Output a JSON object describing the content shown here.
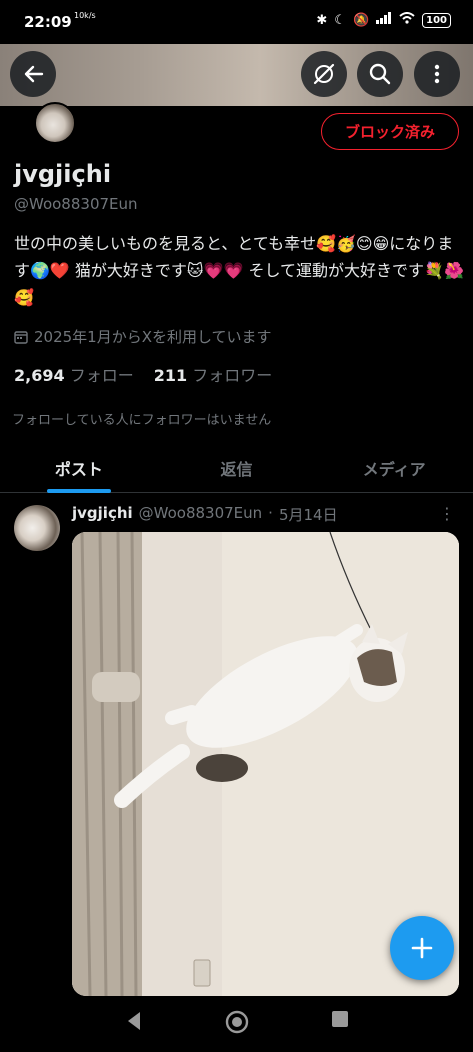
{
  "status": {
    "time": "22:09",
    "network": "10k/s",
    "battery": "100"
  },
  "profile": {
    "name": "jvgjiçhi",
    "handle": "@Woo88307Eun",
    "blocked_label": "ブロック済み",
    "bio": "世の中の美しいものを見ると、とても幸せ🥰🥳😊😁になります🌍❤️ 猫が大好きです🐱💗💗 そして運動が大好きです💐🌺🥰",
    "joined": "2025年1月からXを利用しています",
    "following_count": "2,694",
    "following_label": "フォロー",
    "followers_count": "211",
    "followers_label": "フォロワー",
    "no_mutual": "フォローしている人にフォロワーはいません"
  },
  "tabs": [
    {
      "label": "ポスト",
      "active": true
    },
    {
      "label": "返信",
      "active": false
    },
    {
      "label": "メディア",
      "active": false
    }
  ],
  "post": {
    "name": "jvgjiçhi",
    "handle": "@Woo88307Eun",
    "sep": "·",
    "date": "5月14日"
  },
  "icons": {
    "back": "arrow-left-icon",
    "hide": "eye-slash-icon",
    "search": "search-icon",
    "more": "more-vertical-icon",
    "calendar": "calendar-icon",
    "compose": "plus-icon"
  },
  "colors": {
    "accent": "#1d9bf0",
    "blocked": "#f4212e",
    "muted": "#71767b"
  }
}
